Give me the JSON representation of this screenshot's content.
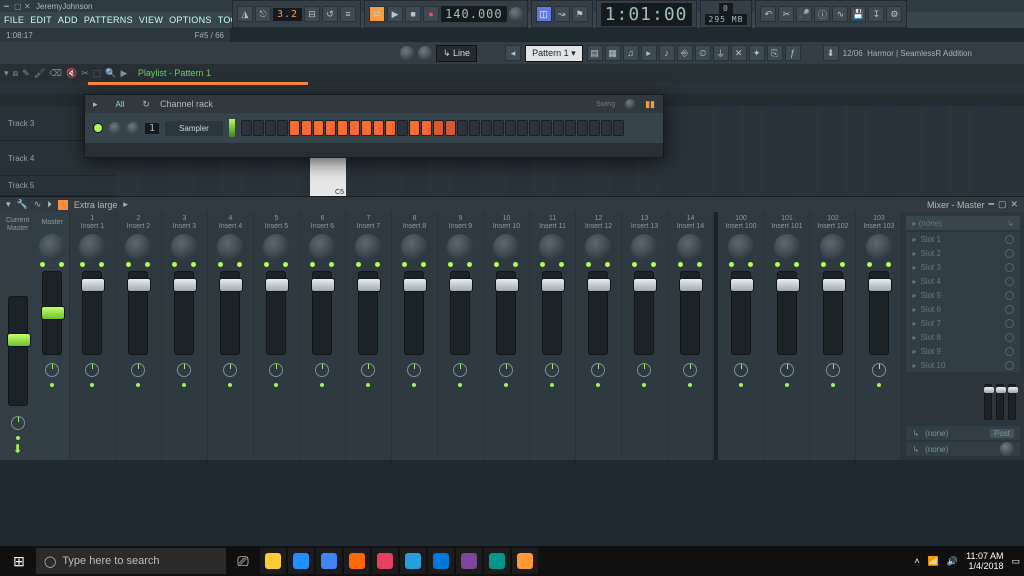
{
  "title_user": "JeremyJohnson",
  "menu": [
    "FILE",
    "EDIT",
    "ADD",
    "PATTERNS",
    "VIEW",
    "OPTIONS",
    "TOOLS",
    "?"
  ],
  "hint_left": "1:08:17",
  "hint_right": "F#5 / 66",
  "transport": {
    "cpu": "3.2",
    "tempo": "140.000",
    "position": "1:01:00",
    "snap": "Line",
    "mem_kb": "0",
    "mem_mb": "295 MB",
    "pattern": "Pattern 1",
    "news_date": "12/06",
    "news_text": "Harmor | SeamlessR Addition"
  },
  "playlist": {
    "title": "Playlist - Pattern 1",
    "pattern_flag": "Pattern 1"
  },
  "tracks": [
    "Track 3",
    "Track 4",
    "Track 5"
  ],
  "piano_note": "C5",
  "channel_rack": {
    "title": "Channel rack",
    "filter": "All",
    "num": "1",
    "channel": "Sampler",
    "swing": "Swing",
    "steps": [
      0,
      0,
      0,
      0,
      1,
      1,
      1,
      1,
      1,
      1,
      1,
      1,
      1,
      0,
      1,
      1,
      2,
      2,
      0,
      0,
      0,
      0,
      0,
      0,
      0,
      0,
      0,
      0,
      0,
      0,
      0,
      0
    ]
  },
  "mixer": {
    "title": "Mixer - Master",
    "size": "Extra large",
    "current": "Current",
    "master_top": "Master",
    "master": "Master",
    "inserts1": [
      {
        "n": "1",
        "l": "Insert 1"
      },
      {
        "n": "2",
        "l": "Insert 2"
      },
      {
        "n": "3",
        "l": "Insert 3"
      },
      {
        "n": "4",
        "l": "Insert 4"
      },
      {
        "n": "5",
        "l": "Insert 5"
      },
      {
        "n": "6",
        "l": "Insert 6"
      },
      {
        "n": "7",
        "l": "Insert 7"
      },
      {
        "n": "8",
        "l": "Insert 8"
      },
      {
        "n": "9",
        "l": "Insert 9"
      },
      {
        "n": "10",
        "l": "Insert 10"
      },
      {
        "n": "11",
        "l": "Insert 11"
      },
      {
        "n": "12",
        "l": "Insert 12"
      },
      {
        "n": "13",
        "l": "Insert 13"
      },
      {
        "n": "14",
        "l": "Insert 14"
      }
    ],
    "inserts2": [
      {
        "n": "100",
        "l": "Insert 100"
      },
      {
        "n": "101",
        "l": "Insert 101"
      },
      {
        "n": "102",
        "l": "Insert 102"
      },
      {
        "n": "103",
        "l": "Insert 103"
      }
    ],
    "fx_header": "(none)",
    "slots": [
      "Slot 1",
      "Slot 2",
      "Slot 3",
      "Slot 4",
      "Slot 5",
      "Slot 6",
      "Slot 7",
      "Slot 8",
      "Slot 9",
      "Slot 10"
    ],
    "send_none": "(none)",
    "post": "Post"
  },
  "taskbar": {
    "search_placeholder": "Type here to search",
    "time": "11:07 AM",
    "date": "1/4/2018",
    "app_colors": [
      "#ffcc33",
      "#1e90ff",
      "#4285f4",
      "#ff6a00",
      "#e4405f",
      "#26a0da",
      "#0078d7",
      "#7d4698",
      "#009688",
      "#ff9933"
    ]
  }
}
